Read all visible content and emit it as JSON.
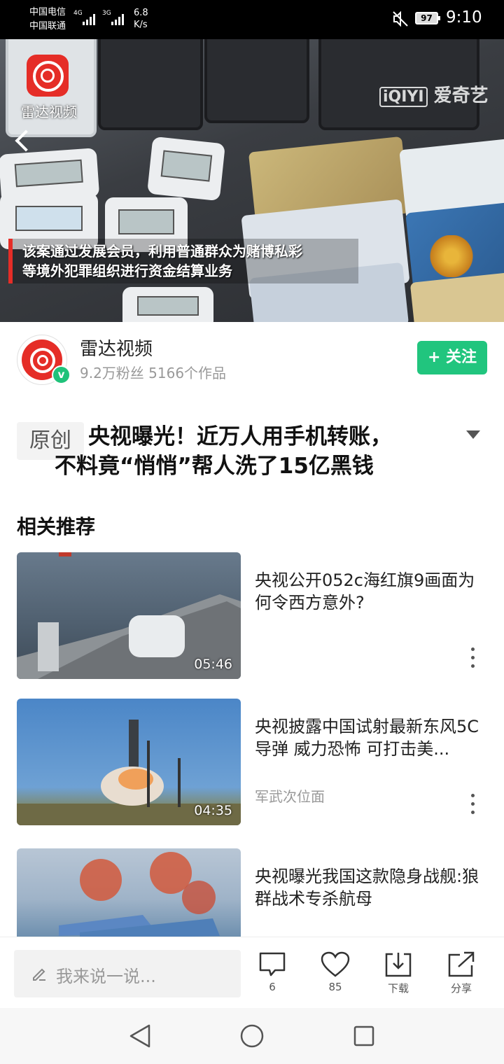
{
  "status_bar": {
    "carrier1": "中国电信",
    "carrier2": "中国联通",
    "net1": "4G",
    "net2": "3G",
    "speed_value": "6.8",
    "speed_unit": "K/s",
    "battery": "97",
    "time": "9:10"
  },
  "video": {
    "channel_watermark": "雷达视频",
    "platform_watermark": "爱奇艺",
    "platform_logo": "iQIYI",
    "subtitle_line1": "该案通过发展会员，利用普通群众为赌博私彩",
    "subtitle_line2": "等境外犯罪组织进行资金结算业务"
  },
  "channel": {
    "name": "雷达视频",
    "meta": "9.2万粉丝  5166个作品",
    "verified_badge": "v",
    "follow_label": "+ 关注"
  },
  "article": {
    "tag": "原创",
    "title_line1": "央视曝光！近万人用手机转账，",
    "title_line2": "不料竟“悄悄”帮人洗了15亿黑钱"
  },
  "recommendations": {
    "heading": "相关推荐",
    "items": [
      {
        "title": "央视公开052c海红旗9画面为何令西方意外?",
        "source": "",
        "duration": "05:46"
      },
      {
        "title": "央视披露中国试射最新东风5C导弹 威力恐怖 可打击美...",
        "source": "军武次位面",
        "duration": "04:35"
      },
      {
        "title": "央视曝光我国这款隐身战舰:狼群战术专杀航母",
        "source": "",
        "duration": ""
      }
    ]
  },
  "bottom_bar": {
    "comment_placeholder": "我来说一说...",
    "comment_count": "6",
    "like_count": "85",
    "download_label": "下载",
    "share_label": "分享"
  },
  "colors": {
    "accent_green": "#21c57e",
    "brand_red": "#e52d27"
  }
}
